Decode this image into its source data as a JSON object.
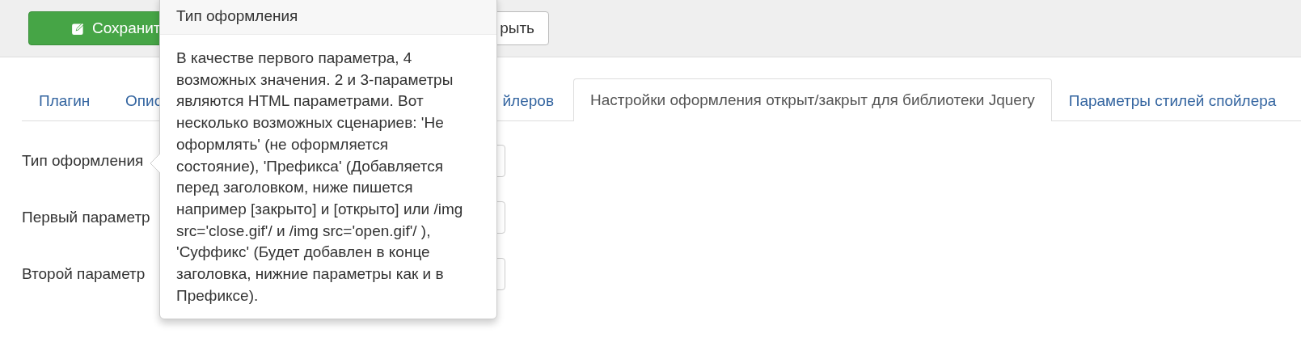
{
  "toolbar": {
    "buttons": [
      {
        "kind": "primary",
        "label": "Сохранит"
      },
      {
        "kind": "default",
        "label": "рыть"
      }
    ]
  },
  "tabs": [
    {
      "label": "Плагин",
      "selected": false
    },
    {
      "label": "Опис",
      "selected": false
    },
    {
      "label": "йлеров",
      "selected": false
    },
    {
      "label": "Настройки оформления открыт/закрыт для библиотеки Jquery",
      "selected": true
    },
    {
      "label": "Параметры стилей спойлера",
      "selected": false
    }
  ],
  "fields": [
    {
      "label": "Тип оформления"
    },
    {
      "label": "Первый параметр"
    },
    {
      "label": "Второй параметр"
    }
  ],
  "popover": {
    "title": "Тип оформления",
    "text": "В качестве первого параметра, 4\nвозможных значения. 2 и 3-параметры\nявляются HTML параметрами. Вот\nнесколько возможных сценариев: 'Не\nоформлять' (не оформляется\nсостояние), 'Префикса' (Добавляется\nперед заголовком, ниже пишется\nнапример [закрыто] и [открыто] или /img\nsrc='close.gif'/ и /img src='open.gif'/ ),\n'Суффикс' (Будет добавлен в конце\nзаголовка, нижние параметры как и в\nПрефиксе)."
  }
}
